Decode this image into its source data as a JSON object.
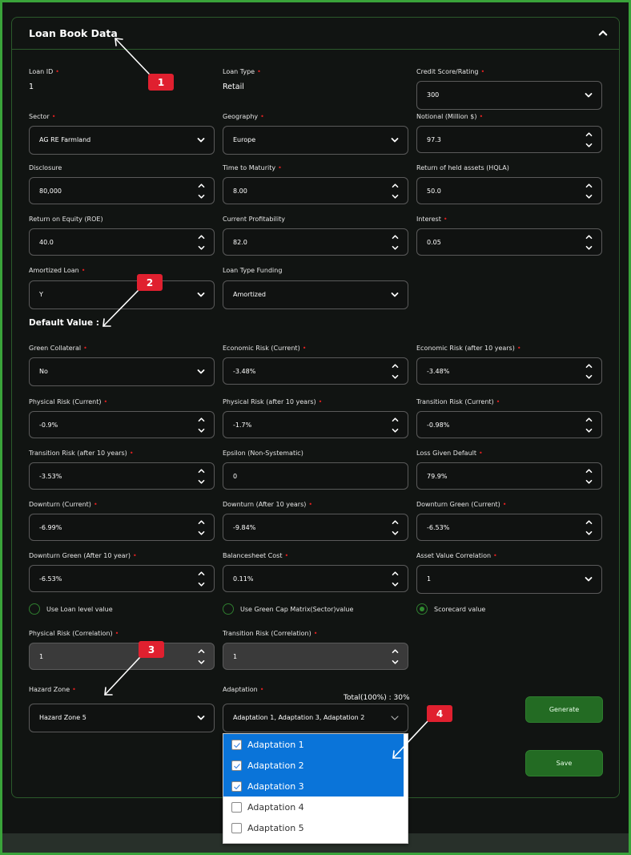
{
  "card": {
    "title": "Loan Book Data"
  },
  "loan": {
    "loan_id": {
      "label": "Loan ID",
      "required": true,
      "value": "1"
    },
    "loan_type": {
      "label": "Loan Type",
      "required": true,
      "value": "Retail"
    },
    "credit_score": {
      "label": "Credit Score/Rating",
      "required": true,
      "value": "300"
    },
    "sector": {
      "label": "Sector",
      "required": true,
      "value": "AG RE Farmland"
    },
    "geography": {
      "label": "Geography",
      "required": true,
      "value": "Europe"
    },
    "notional": {
      "label": "Notional (Million $)",
      "required": true,
      "value": "97.3"
    },
    "disclosure": {
      "label": "Disclosure",
      "required": false,
      "value": "80,000"
    },
    "time_to_maturity": {
      "label": "Time to Maturity",
      "required": true,
      "value": "8.00"
    },
    "return_held_assets": {
      "label": "Return of held assets (HQLA)",
      "required": false,
      "value": "50.0"
    },
    "roe": {
      "label": "Return on Equity (ROE)",
      "required": false,
      "value": "40.0"
    },
    "current_profitability": {
      "label": "Current Profitability",
      "required": false,
      "value": "82.0"
    },
    "interest": {
      "label": "Interest",
      "required": true,
      "value": "0.05"
    },
    "amortized_loan": {
      "label": "Amortized Loan",
      "required": true,
      "value": "Y"
    },
    "loan_type_funding": {
      "label": "Loan Type Funding",
      "required": false,
      "value": "Amortized"
    }
  },
  "default_section": {
    "title": "Default Value :",
    "green_collateral": {
      "label": "Green Collateral",
      "value": "No"
    },
    "economic_risk_current": {
      "label": "Economic Risk (Current)",
      "value": "-3.48%"
    },
    "economic_risk_10y": {
      "label": "Economic Risk (after 10 years)",
      "value": "-3.48%"
    },
    "physical_risk_current": {
      "label": "Physical Risk (Current)",
      "value": "-0.9%"
    },
    "physical_risk_10y": {
      "label": "Physical Risk (after 10 years)",
      "value": "-1.7%"
    },
    "transition_risk_current": {
      "label": "Transition Risk (Current)",
      "value": "-0.98%"
    },
    "transition_risk_10y": {
      "label": "Transition Risk (after 10 years)",
      "value": "-3.53%"
    },
    "epsilon": {
      "label": "Epsilon (Non-Systematic)",
      "value": "0"
    },
    "lgd": {
      "label": "Loss Given Default",
      "value": "79.9%"
    },
    "downturn_current": {
      "label": "Downturn (Current)",
      "value": "-6.99%"
    },
    "downturn_10y": {
      "label": "Downturn (After 10 years)",
      "value": "-9.84%"
    },
    "downturn_green_current": {
      "label": "Downturn Green (Current)",
      "value": "-6.53%"
    },
    "downturn_green_10y": {
      "label": "Downturn Green (After 10 year)",
      "value": "-6.53%"
    },
    "balancesheet_cost": {
      "label": "Balancesheet Cost",
      "value": "0.11%"
    },
    "asset_value_correlation": {
      "label": "Asset Value Correlation",
      "value": "1"
    },
    "radios": [
      {
        "label": "Use Loan level value",
        "checked": false
      },
      {
        "label": "Use Green Cap Matrix(Sector)value",
        "checked": false
      },
      {
        "label": "Scorecard value",
        "checked": true
      }
    ],
    "physical_risk_corr": {
      "label": "Physical Risk (Correlation)",
      "value": "1"
    },
    "transition_risk_corr": {
      "label": "Transition Risk (Correlation)",
      "value": "1"
    },
    "hazard_zone": {
      "label": "Hazard Zone",
      "value": "Hazard Zone 5"
    },
    "adaptation": {
      "label": "Adaptation",
      "total_label": "Total(100%) : 30%",
      "value": "Adaptation 1, Adaptation 3, Adaptation 2",
      "options": [
        {
          "label": "Adaptation 1",
          "checked": true
        },
        {
          "label": "Adaptation 2",
          "checked": true
        },
        {
          "label": "Adaptation 3",
          "checked": true
        },
        {
          "label": "Adaptation 4",
          "checked": false
        },
        {
          "label": "Adaptation 5",
          "checked": false
        }
      ]
    }
  },
  "buttons": {
    "generate": "Generate",
    "save": "Save"
  },
  "annotations": [
    "1",
    "2",
    "3",
    "4"
  ],
  "colors": {
    "accent_green": "#236b23",
    "border_green": "#3aa33a",
    "required": "#e02020",
    "selection_blue": "#0a74d9",
    "annotation_red": "#e0202f"
  }
}
